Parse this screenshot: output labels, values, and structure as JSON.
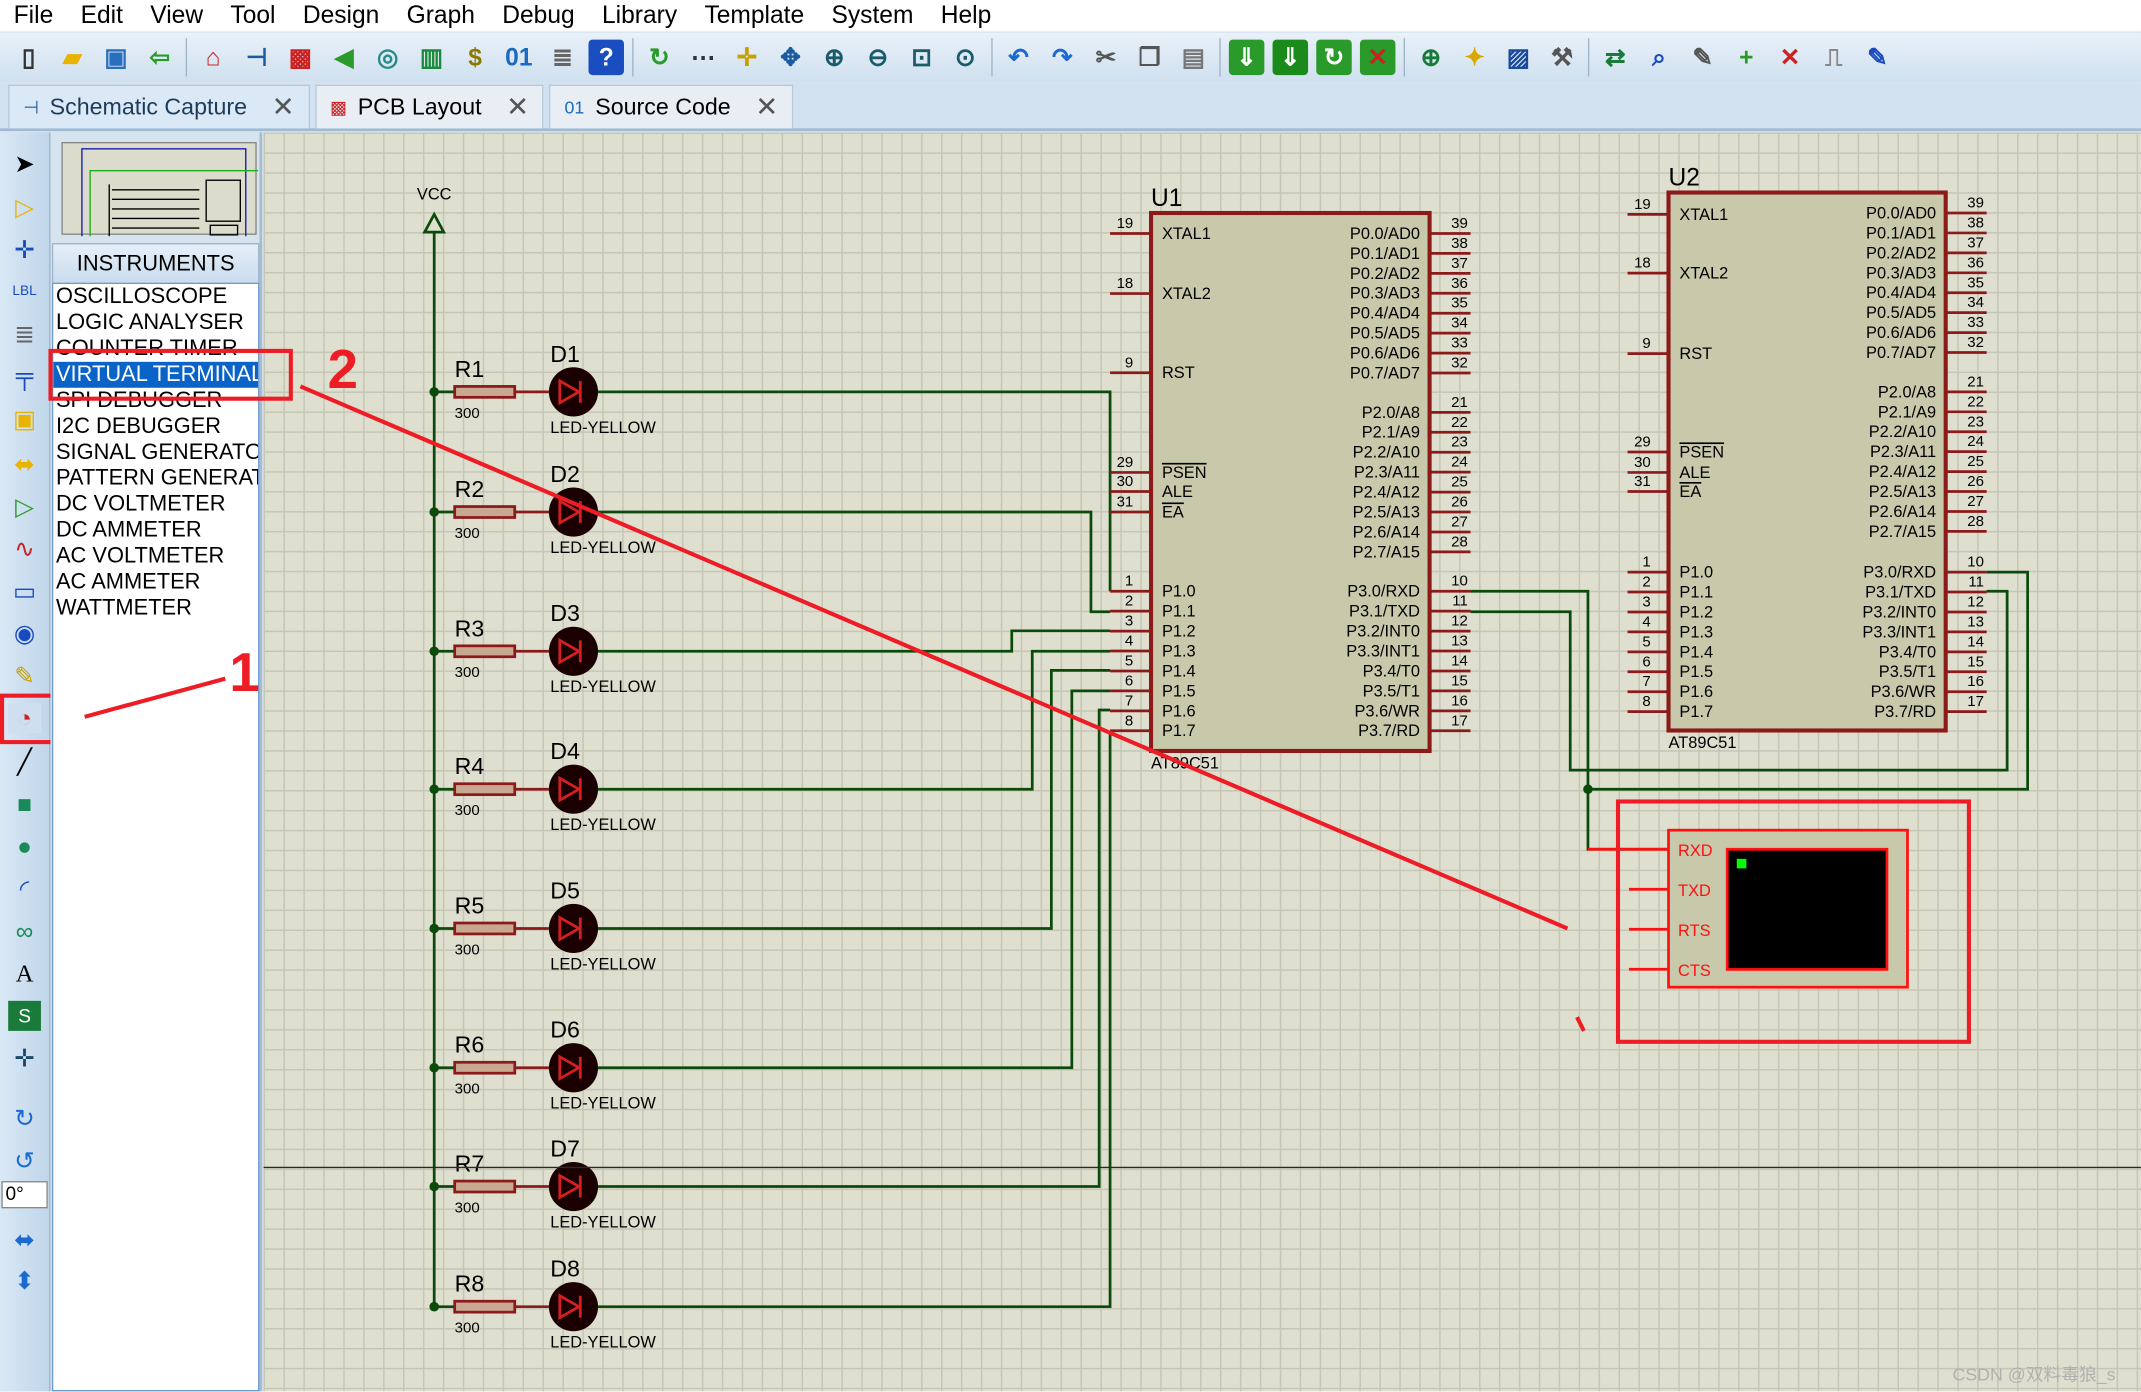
{
  "menu": [
    "File",
    "Edit",
    "View",
    "Tool",
    "Design",
    "Graph",
    "Debug",
    "Library",
    "Template",
    "System",
    "Help"
  ],
  "toolbar_icons": [
    {
      "name": "new-file-icon",
      "glyph": "▯",
      "color": "#333"
    },
    {
      "name": "open-folder-icon",
      "glyph": "▰",
      "color": "#e8b400"
    },
    {
      "name": "save-icon",
      "glyph": "▣",
      "color": "#2a6fbf"
    },
    {
      "name": "import-icon",
      "glyph": "⇦",
      "color": "#2a9a2a"
    },
    {
      "name": "home-icon",
      "glyph": "⌂",
      "color": "#c22"
    },
    {
      "name": "schematic-icon",
      "glyph": "⊣",
      "color": "#1a5aa0"
    },
    {
      "name": "pcb-icon",
      "glyph": "▩",
      "color": "#c22"
    },
    {
      "name": "3d-view-icon",
      "glyph": "◀",
      "color": "#2a9a2a"
    },
    {
      "name": "gerber-icon",
      "glyph": "◎",
      "color": "#2a8a8a"
    },
    {
      "name": "design-explorer-icon",
      "glyph": "▥",
      "color": "#1a8a3a"
    },
    {
      "name": "bill-of-materials-icon",
      "glyph": "$",
      "color": "#8a7a00"
    },
    {
      "name": "source-code-icon",
      "glyph": "01",
      "color": "#1a6ac0"
    },
    {
      "name": "notes-icon",
      "glyph": "≣",
      "color": "#666"
    },
    {
      "name": "help-icon",
      "glyph": "?",
      "color": "#fff",
      "bg": "#1a4ec0"
    },
    {
      "name": "refresh-icon",
      "glyph": "↻",
      "color": "#2a9a2a"
    },
    {
      "name": "grid-icon",
      "glyph": "⋯",
      "color": "#333"
    },
    {
      "name": "origin-icon",
      "glyph": "✛",
      "color": "#c9a000"
    },
    {
      "name": "pan-icon",
      "glyph": "✥",
      "color": "#1a5aa0"
    },
    {
      "name": "zoom-in-icon",
      "glyph": "⊕",
      "color": "#1a5a6a"
    },
    {
      "name": "zoom-out-icon",
      "glyph": "⊖",
      "color": "#1a5a6a"
    },
    {
      "name": "zoom-all-icon",
      "glyph": "⊡",
      "color": "#1a5a6a"
    },
    {
      "name": "zoom-area-icon",
      "glyph": "⊙",
      "color": "#1a5a6a"
    },
    {
      "name": "undo-icon",
      "glyph": "↶",
      "color": "#1a6ad0"
    },
    {
      "name": "redo-icon",
      "glyph": "↷",
      "color": "#1a6ad0"
    },
    {
      "name": "cut-icon",
      "glyph": "✂",
      "color": "#555"
    },
    {
      "name": "copy-icon",
      "glyph": "❐",
      "color": "#555"
    },
    {
      "name": "paste-icon",
      "glyph": "▤",
      "color": "#777"
    },
    {
      "name": "block-copy-icon",
      "glyph": "⇓",
      "color": "#fff",
      "bg": "#2a9a2a"
    },
    {
      "name": "block-move-icon",
      "glyph": "⇓",
      "color": "#fff",
      "bg": "#1a8a1a"
    },
    {
      "name": "block-rotate-icon",
      "glyph": "↻",
      "color": "#fff",
      "bg": "#2a9a2a"
    },
    {
      "name": "block-delete-icon",
      "glyph": "✕",
      "color": "#c22",
      "bg": "#2a9a2a"
    },
    {
      "name": "pick-device-icon",
      "glyph": "⊕",
      "color": "#1a7a3a"
    },
    {
      "name": "make-device-icon",
      "glyph": "✦",
      "color": "#d8a800"
    },
    {
      "name": "packaging-tool-icon",
      "glyph": "▨",
      "color": "#1a4a9a"
    },
    {
      "name": "decompose-icon",
      "glyph": "⚒",
      "color": "#555"
    },
    {
      "name": "wire-autorouter-icon",
      "glyph": "⇄",
      "color": "#1a7a3a"
    },
    {
      "name": "search-tag-icon",
      "glyph": "⌕",
      "color": "#1a4ac0"
    },
    {
      "name": "property-tool-icon",
      "glyph": "✎",
      "color": "#555"
    },
    {
      "name": "new-sheet-icon",
      "glyph": "+",
      "color": "#2a9a2a"
    },
    {
      "name": "remove-sheet-icon",
      "glyph": "✕",
      "color": "#c22"
    },
    {
      "name": "exit-to-parent-icon",
      "glyph": "⎍",
      "color": "#888"
    },
    {
      "name": "design-report-icon",
      "glyph": "✎",
      "color": "#1a4ac0"
    }
  ],
  "tabs": [
    {
      "label": "Schematic Capture",
      "active": true
    },
    {
      "label": "PCB Layout"
    },
    {
      "label": "Source Code"
    }
  ],
  "panel": {
    "header": "INSTRUMENTS",
    "items": [
      "OSCILLOSCOPE",
      "LOGIC ANALYSER",
      "COUNTER TIMER",
      "VIRTUAL TERMINAL",
      "SPI DEBUGGER",
      "I2C DEBUGGER",
      "SIGNAL GENERATOR",
      "PATTERN GENERATOR",
      "DC VOLTMETER",
      "DC AMMETER",
      "AC VOLTMETER",
      "AC AMMETER",
      "WATTMETER"
    ],
    "selected": "VIRTUAL TERMINAL"
  },
  "rotation": "0°",
  "schematic": {
    "vcc": "VCC",
    "resistor_value": "300",
    "led_type": "LED-YELLOW",
    "resistors": [
      "R1",
      "R2",
      "R3",
      "R4",
      "R5",
      "R6",
      "R7",
      "R8"
    ],
    "leds": [
      "D1",
      "D2",
      "D3",
      "D4",
      "D5",
      "D6",
      "D7",
      "D8"
    ],
    "u1": {
      "ref": "U1",
      "part": "AT89C51"
    },
    "u2": {
      "ref": "U2",
      "part": "AT89C51"
    },
    "left_pins": [
      [
        "19",
        "XTAL1"
      ],
      [
        "18",
        "XTAL2"
      ],
      [
        "9",
        "RST"
      ],
      [
        "29",
        "PSEN"
      ],
      [
        "30",
        "ALE"
      ],
      [
        "31",
        "EA"
      ],
      [
        "1",
        "P1.0"
      ],
      [
        "2",
        "P1.1"
      ],
      [
        "3",
        "P1.2"
      ],
      [
        "4",
        "P1.3"
      ],
      [
        "5",
        "P1.4"
      ],
      [
        "6",
        "P1.5"
      ],
      [
        "7",
        "P1.6"
      ],
      [
        "8",
        "P1.7"
      ]
    ],
    "right_pins": [
      [
        "39",
        "P0.0/AD0"
      ],
      [
        "38",
        "P0.1/AD1"
      ],
      [
        "37",
        "P0.2/AD2"
      ],
      [
        "36",
        "P0.3/AD3"
      ],
      [
        "35",
        "P0.4/AD4"
      ],
      [
        "34",
        "P0.5/AD5"
      ],
      [
        "33",
        "P0.6/AD6"
      ],
      [
        "32",
        "P0.7/AD7"
      ],
      [
        "21",
        "P2.0/A8"
      ],
      [
        "22",
        "P2.1/A9"
      ],
      [
        "23",
        "P2.2/A10"
      ],
      [
        "24",
        "P2.3/A11"
      ],
      [
        "25",
        "P2.4/A12"
      ],
      [
        "26",
        "P2.5/A13"
      ],
      [
        "27",
        "P2.6/A14"
      ],
      [
        "28",
        "P2.7/A15"
      ],
      [
        "10",
        "P3.0/RXD"
      ],
      [
        "11",
        "P3.1/TXD"
      ],
      [
        "12",
        "P3.2/INT0"
      ],
      [
        "13",
        "P3.3/INT1"
      ],
      [
        "14",
        "P3.4/T0"
      ],
      [
        "15",
        "P3.5/T1"
      ],
      [
        "16",
        "P3.6/WR"
      ],
      [
        "17",
        "P3.7/RD"
      ]
    ],
    "terminal_pins": [
      "RXD",
      "TXD",
      "RTS",
      "CTS"
    ]
  },
  "annotations": {
    "step1": "1",
    "step2": "2"
  },
  "watermark": "CSDN @双料毒狼_s",
  "colors": {
    "wire": "#0b4a0b",
    "component": "#8b1a1a",
    "body": "#c8c8aa",
    "annotation": "#ee1c24",
    "selection": "#0a64c8"
  }
}
